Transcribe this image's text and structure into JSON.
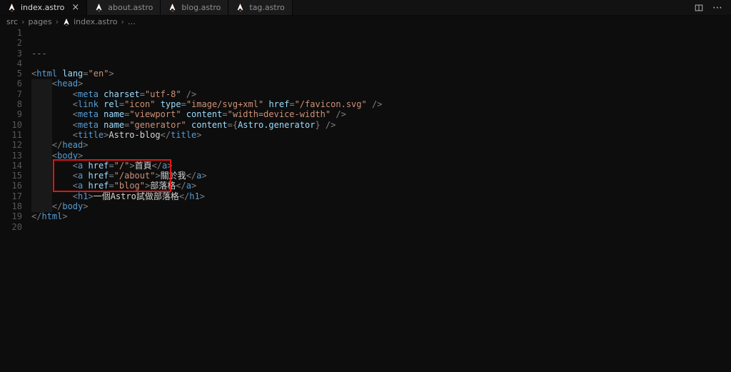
{
  "colors": {
    "annotation_red": "#e01515",
    "astro_orange": "#ff5d01",
    "tag_blue": "#569cd6",
    "attr_blue": "#9cdcfe",
    "string_orange": "#ce9178"
  },
  "tab_bar": {
    "close_glyph": "×",
    "more_glyph": "⋯",
    "tabs": [
      {
        "label": "index.astro",
        "active": true
      },
      {
        "label": "about.astro",
        "active": false
      },
      {
        "label": "blog.astro",
        "active": false
      },
      {
        "label": "tag.astro",
        "active": false
      }
    ]
  },
  "breadcrumb": {
    "separator": "›",
    "items": [
      {
        "label": "src",
        "icon": false
      },
      {
        "label": "pages",
        "icon": false
      },
      {
        "label": "index.astro",
        "icon": true
      },
      {
        "label": "…",
        "icon": false
      }
    ]
  },
  "editor": {
    "annotation": {
      "shape": "rectangle",
      "color": "#e01515",
      "highlight_lines": [
        14,
        15,
        16
      ]
    },
    "lines": [
      {
        "n": 1,
        "tokens": []
      },
      {
        "n": 2,
        "tokens": []
      },
      {
        "n": 3,
        "tokens": [
          {
            "c": "fence",
            "t": "---"
          }
        ]
      },
      {
        "n": 4,
        "tokens": []
      },
      {
        "n": 5,
        "tokens": [
          {
            "c": "punct",
            "t": "<"
          },
          {
            "c": "tag",
            "t": "html"
          },
          {
            "c": "plain",
            "t": " "
          },
          {
            "c": "attr",
            "t": "lang"
          },
          {
            "c": "punct",
            "t": "="
          },
          {
            "c": "str",
            "t": "\"en\""
          },
          {
            "c": "punct",
            "t": ">"
          }
        ]
      },
      {
        "n": 6,
        "tokens": [
          {
            "c": "plain",
            "t": "    "
          },
          {
            "c": "punct",
            "t": "<"
          },
          {
            "c": "tag",
            "t": "head"
          },
          {
            "c": "punct",
            "t": ">"
          }
        ]
      },
      {
        "n": 7,
        "tokens": [
          {
            "c": "plain",
            "t": "        "
          },
          {
            "c": "punct",
            "t": "<"
          },
          {
            "c": "tag",
            "t": "meta"
          },
          {
            "c": "plain",
            "t": " "
          },
          {
            "c": "attr",
            "t": "charset"
          },
          {
            "c": "punct",
            "t": "="
          },
          {
            "c": "str",
            "t": "\"utf-8\""
          },
          {
            "c": "plain",
            "t": " "
          },
          {
            "c": "punct",
            "t": "/>"
          }
        ]
      },
      {
        "n": 8,
        "tokens": [
          {
            "c": "plain",
            "t": "        "
          },
          {
            "c": "punct",
            "t": "<"
          },
          {
            "c": "tag",
            "t": "link"
          },
          {
            "c": "plain",
            "t": " "
          },
          {
            "c": "attr",
            "t": "rel"
          },
          {
            "c": "punct",
            "t": "="
          },
          {
            "c": "str",
            "t": "\"icon\""
          },
          {
            "c": "plain",
            "t": " "
          },
          {
            "c": "attr",
            "t": "type"
          },
          {
            "c": "punct",
            "t": "="
          },
          {
            "c": "str",
            "t": "\"image/svg+xml\""
          },
          {
            "c": "plain",
            "t": " "
          },
          {
            "c": "attr",
            "t": "href"
          },
          {
            "c": "punct",
            "t": "="
          },
          {
            "c": "str",
            "t": "\"/favicon.svg\""
          },
          {
            "c": "plain",
            "t": " "
          },
          {
            "c": "punct",
            "t": "/>"
          }
        ]
      },
      {
        "n": 9,
        "tokens": [
          {
            "c": "plain",
            "t": "        "
          },
          {
            "c": "punct",
            "t": "<"
          },
          {
            "c": "tag",
            "t": "meta"
          },
          {
            "c": "plain",
            "t": " "
          },
          {
            "c": "attr",
            "t": "name"
          },
          {
            "c": "punct",
            "t": "="
          },
          {
            "c": "str",
            "t": "\"viewport\""
          },
          {
            "c": "plain",
            "t": " "
          },
          {
            "c": "attr",
            "t": "content"
          },
          {
            "c": "punct",
            "t": "="
          },
          {
            "c": "str",
            "t": "\"width=device-width\""
          },
          {
            "c": "plain",
            "t": " "
          },
          {
            "c": "punct",
            "t": "/>"
          }
        ]
      },
      {
        "n": 10,
        "tokens": [
          {
            "c": "plain",
            "t": "        "
          },
          {
            "c": "punct",
            "t": "<"
          },
          {
            "c": "tag",
            "t": "meta"
          },
          {
            "c": "plain",
            "t": " "
          },
          {
            "c": "attr",
            "t": "name"
          },
          {
            "c": "punct",
            "t": "="
          },
          {
            "c": "str",
            "t": "\"generator\""
          },
          {
            "c": "plain",
            "t": " "
          },
          {
            "c": "attr",
            "t": "content"
          },
          {
            "c": "punct",
            "t": "="
          },
          {
            "c": "punct",
            "t": "{"
          },
          {
            "c": "expr",
            "t": "Astro.generator"
          },
          {
            "c": "punct",
            "t": "}"
          },
          {
            "c": "plain",
            "t": " "
          },
          {
            "c": "punct",
            "t": "/>"
          }
        ]
      },
      {
        "n": 11,
        "tokens": [
          {
            "c": "plain",
            "t": "        "
          },
          {
            "c": "punct",
            "t": "<"
          },
          {
            "c": "tag",
            "t": "title"
          },
          {
            "c": "punct",
            "t": ">"
          },
          {
            "c": "plain",
            "t": "Astro-blog"
          },
          {
            "c": "punct",
            "t": "</"
          },
          {
            "c": "tag",
            "t": "title"
          },
          {
            "c": "punct",
            "t": ">"
          }
        ]
      },
      {
        "n": 12,
        "tokens": [
          {
            "c": "plain",
            "t": "    "
          },
          {
            "c": "punct",
            "t": "</"
          },
          {
            "c": "tag",
            "t": "head"
          },
          {
            "c": "punct",
            "t": ">"
          }
        ]
      },
      {
        "n": 13,
        "tokens": [
          {
            "c": "plain",
            "t": "    "
          },
          {
            "c": "punct",
            "t": "<"
          },
          {
            "c": "tag",
            "t": "body"
          },
          {
            "c": "punct",
            "t": ">"
          }
        ]
      },
      {
        "n": 14,
        "tokens": [
          {
            "c": "plain",
            "t": "        "
          },
          {
            "c": "punct",
            "t": "<"
          },
          {
            "c": "tag",
            "t": "a"
          },
          {
            "c": "plain",
            "t": " "
          },
          {
            "c": "attr",
            "t": "href"
          },
          {
            "c": "punct",
            "t": "="
          },
          {
            "c": "str",
            "t": "\"/\""
          },
          {
            "c": "punct",
            "t": ">"
          },
          {
            "c": "plain",
            "t": "首頁"
          },
          {
            "c": "punct",
            "t": "</"
          },
          {
            "c": "tag",
            "t": "a"
          },
          {
            "c": "punct",
            "t": ">"
          }
        ]
      },
      {
        "n": 15,
        "tokens": [
          {
            "c": "plain",
            "t": "        "
          },
          {
            "c": "punct",
            "t": "<"
          },
          {
            "c": "tag",
            "t": "a"
          },
          {
            "c": "plain",
            "t": " "
          },
          {
            "c": "attr",
            "t": "href"
          },
          {
            "c": "punct",
            "t": "="
          },
          {
            "c": "str",
            "t": "\"/about\""
          },
          {
            "c": "punct",
            "t": ">"
          },
          {
            "c": "plain",
            "t": "關於我"
          },
          {
            "c": "punct",
            "t": "</"
          },
          {
            "c": "tag",
            "t": "a"
          },
          {
            "c": "punct",
            "t": ">"
          }
        ]
      },
      {
        "n": 16,
        "tokens": [
          {
            "c": "plain",
            "t": "        "
          },
          {
            "c": "punct",
            "t": "<"
          },
          {
            "c": "tag",
            "t": "a"
          },
          {
            "c": "plain",
            "t": " "
          },
          {
            "c": "attr",
            "t": "href"
          },
          {
            "c": "punct",
            "t": "="
          },
          {
            "c": "str",
            "t": "\"blog\""
          },
          {
            "c": "punct",
            "t": ">"
          },
          {
            "c": "plain",
            "t": "部落格"
          },
          {
            "c": "punct",
            "t": "</"
          },
          {
            "c": "tag",
            "t": "a"
          },
          {
            "c": "punct",
            "t": ">"
          }
        ]
      },
      {
        "n": 17,
        "tokens": [
          {
            "c": "plain",
            "t": "        "
          },
          {
            "c": "punct",
            "t": "<"
          },
          {
            "c": "tag",
            "t": "h1"
          },
          {
            "c": "punct",
            "t": ">"
          },
          {
            "c": "plain",
            "t": "一個Astro試做部落格"
          },
          {
            "c": "punct",
            "t": "</"
          },
          {
            "c": "tag",
            "t": "h1"
          },
          {
            "c": "punct",
            "t": ">"
          }
        ]
      },
      {
        "n": 18,
        "tokens": [
          {
            "c": "plain",
            "t": "    "
          },
          {
            "c": "punct",
            "t": "</"
          },
          {
            "c": "tag",
            "t": "body"
          },
          {
            "c": "punct",
            "t": ">"
          }
        ]
      },
      {
        "n": 19,
        "tokens": [
          {
            "c": "punct",
            "t": "</"
          },
          {
            "c": "tag",
            "t": "html"
          },
          {
            "c": "punct",
            "t": ">"
          }
        ]
      },
      {
        "n": 20,
        "tokens": []
      }
    ]
  }
}
